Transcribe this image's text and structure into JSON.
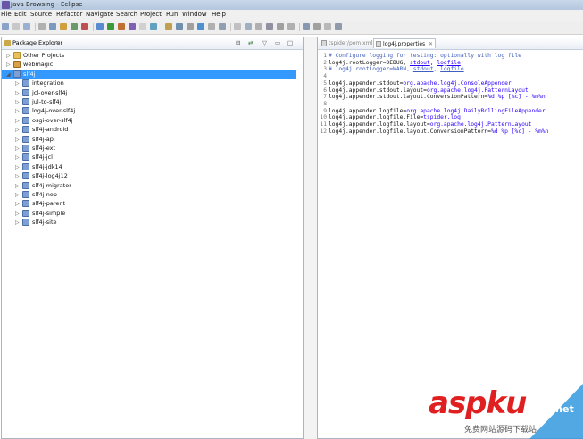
{
  "window": {
    "title": "Java Browsing - Eclipse"
  },
  "menus": [
    "File",
    "Edit",
    "Source",
    "Refactor",
    "Navigate",
    "Search",
    "Project",
    "Run",
    "Window",
    "Help"
  ],
  "package_explorer": {
    "title": "Package Explorer",
    "items": [
      {
        "label": "Other Projects",
        "icon": "folder-icon",
        "expanded": false
      },
      {
        "label": "webmagic",
        "icon": "web-project-icon",
        "expanded": false
      },
      {
        "label": "slf4j",
        "icon": "project-icon",
        "expanded": true,
        "selected": true
      },
      {
        "label": "integration",
        "icon": "project-icon",
        "child": true
      },
      {
        "label": "jcl-over-slf4j",
        "icon": "project-icon",
        "child": true
      },
      {
        "label": "jul-to-slf4j",
        "icon": "project-icon",
        "child": true
      },
      {
        "label": "log4j-over-slf4j",
        "icon": "project-icon",
        "child": true
      },
      {
        "label": "osgi-over-slf4j",
        "icon": "project-icon",
        "child": true
      },
      {
        "label": "slf4j-android",
        "icon": "project-icon",
        "child": true
      },
      {
        "label": "slf4j-api",
        "icon": "project-icon",
        "child": true
      },
      {
        "label": "slf4j-ext",
        "icon": "project-icon",
        "child": true
      },
      {
        "label": "slf4j-jcl",
        "icon": "project-icon",
        "child": true
      },
      {
        "label": "slf4j-jdk14",
        "icon": "project-icon",
        "child": true
      },
      {
        "label": "slf4j-log4j12",
        "icon": "project-icon",
        "child": true
      },
      {
        "label": "slf4j-migrator",
        "icon": "project-icon",
        "child": true
      },
      {
        "label": "slf4j-nop",
        "icon": "project-icon",
        "child": true
      },
      {
        "label": "slf4j-parent",
        "icon": "project-icon",
        "child": true
      },
      {
        "label": "slf4j-simple",
        "icon": "project-icon",
        "child": true
      },
      {
        "label": "slf4j-site",
        "icon": "project-icon",
        "child": true
      }
    ]
  },
  "editor": {
    "tabs": [
      {
        "label": "tspider/pom.xml",
        "active": false
      },
      {
        "label": "log4j.properties",
        "active": true
      }
    ],
    "lines": [
      {
        "n": "1",
        "parts": [
          {
            "t": "# Configure logging for testing: optionally with log file",
            "c": "cm"
          }
        ]
      },
      {
        "n": "2",
        "parts": [
          {
            "t": "log4j.rootLogger=DEBUG, ",
            "c": "key"
          },
          {
            "t": "stdout",
            "c": "val ul"
          },
          {
            "t": ", ",
            "c": "key"
          },
          {
            "t": "logfile",
            "c": "val ul"
          }
        ]
      },
      {
        "n": "3",
        "parts": [
          {
            "t": "# log4j.rootLogger=WARN, ",
            "c": "cm"
          },
          {
            "t": "stdout",
            "c": "cm ul"
          },
          {
            "t": ", ",
            "c": "cm"
          },
          {
            "t": "logfile",
            "c": "cm ul"
          }
        ]
      },
      {
        "n": "4",
        "parts": [
          {
            "t": "",
            "c": "key"
          }
        ]
      },
      {
        "n": "5",
        "parts": [
          {
            "t": "log4j.appender.stdout=",
            "c": "key"
          },
          {
            "t": "org.apache.log4j.ConsoleAppender",
            "c": "val"
          }
        ]
      },
      {
        "n": "6",
        "parts": [
          {
            "t": "log4j.appender.stdout.layout=",
            "c": "key"
          },
          {
            "t": "org.apache.log4j.PatternLayout",
            "c": "val"
          }
        ]
      },
      {
        "n": "7",
        "parts": [
          {
            "t": "log4j.appender.stdout.layout.ConversionPattern=",
            "c": "key"
          },
          {
            "t": "%d %p [%c] - %m%n",
            "c": "val"
          }
        ]
      },
      {
        "n": "8",
        "parts": [
          {
            "t": "",
            "c": "key"
          }
        ]
      },
      {
        "n": "9",
        "parts": [
          {
            "t": "log4j.appender.logfile=",
            "c": "key"
          },
          {
            "t": "org.apache.log4j.DailyRollingFileAppender",
            "c": "val"
          }
        ]
      },
      {
        "n": "10",
        "parts": [
          {
            "t": "log4j.appender.logfile.File=",
            "c": "key"
          },
          {
            "t": "tspider.log",
            "c": "val"
          }
        ]
      },
      {
        "n": "11",
        "parts": [
          {
            "t": "log4j.appender.logfile.layout=",
            "c": "key"
          },
          {
            "t": "org.apache.log4j.PatternLayout",
            "c": "val"
          }
        ]
      },
      {
        "n": "12",
        "parts": [
          {
            "t": "log4j.appender.logfile.layout.ConversionPattern=",
            "c": "key"
          },
          {
            "t": "%d %p [%c] - %m%n",
            "c": "val"
          }
        ]
      }
    ]
  },
  "watermark": {
    "logo": "aspku",
    "net": ".net",
    "sub": "免费网站源码下载站"
  }
}
